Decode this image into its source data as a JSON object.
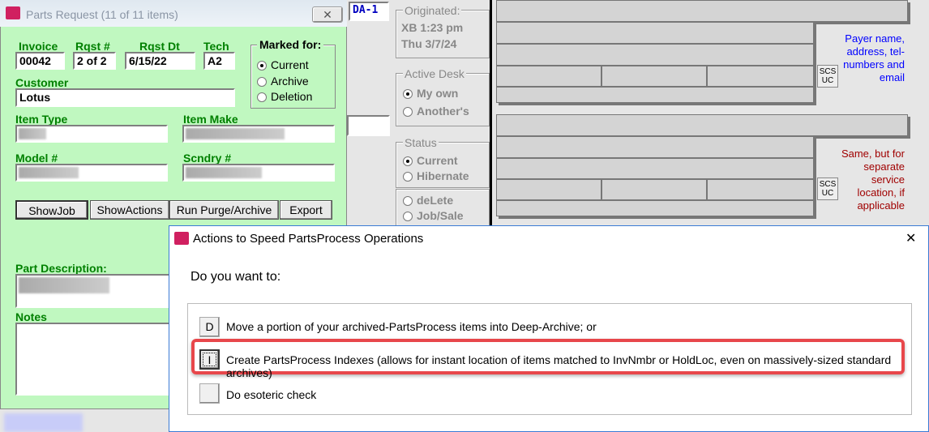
{
  "parts_request": {
    "title": "Parts Request (11 of 11 items)",
    "close": "✕",
    "invoice_label": "Invoice",
    "invoice": "00042",
    "rqst_label": "Rqst #",
    "rqst": "2 of 2",
    "rqst_dt_label": "Rqst Dt",
    "rqst_dt": "6/15/22",
    "tech_label": "Tech",
    "tech": "A2",
    "marked_for": {
      "label": "Marked for:",
      "options": [
        "Current",
        "Archive",
        "Deletion"
      ],
      "selected": "Current"
    },
    "customer_label": "Customer",
    "customer": "Lotus",
    "item_type_label": "Item Type",
    "item_make_label": "Item Make",
    "model_label": "Model #",
    "scndry_label": "Scndry #",
    "buttons": [
      "ShowJob",
      "ShowActions",
      "Run Purge/Archive",
      "Export"
    ],
    "part_desc_label": "Part Description:",
    "notes_label": "Notes"
  },
  "background": {
    "desk_id": "DA-1",
    "originated_label": "Originated:",
    "originated_line1": "XB 1:23 pm",
    "originated_line2": "Thu 3/7/24",
    "active_desk_label": "Active Desk",
    "active_desk_options": [
      "My own",
      "Another's"
    ],
    "status_label": "Status",
    "status_options": [
      "Current",
      "Hibernate"
    ],
    "extra_options": [
      "deLete",
      "Job/Sale"
    ],
    "scs_label": "SCS",
    "uc_label": "UC",
    "payer_note": "Payer name, address, tel-numbers and email",
    "service_note": "Same, but for separate service location, if applicable",
    "payer_color": "#0000ff",
    "service_color": "#a00000"
  },
  "dialog": {
    "title": "Actions to Speed PartsProcess Operations",
    "close": "✕",
    "prompt": "Do you want to:",
    "options": [
      {
        "key": "D",
        "label": "Move a portion of your archived-PartsProcess items into Deep-Archive; or"
      },
      {
        "key": "I",
        "label": "Create PartsProcess Indexes (allows for instant location of items matched to InvNmbr or HoldLoc, even on massively-sized standard archives)"
      },
      {
        "key": "",
        "label": "Do esoteric check"
      }
    ],
    "highlight_color": "#e8474b"
  }
}
